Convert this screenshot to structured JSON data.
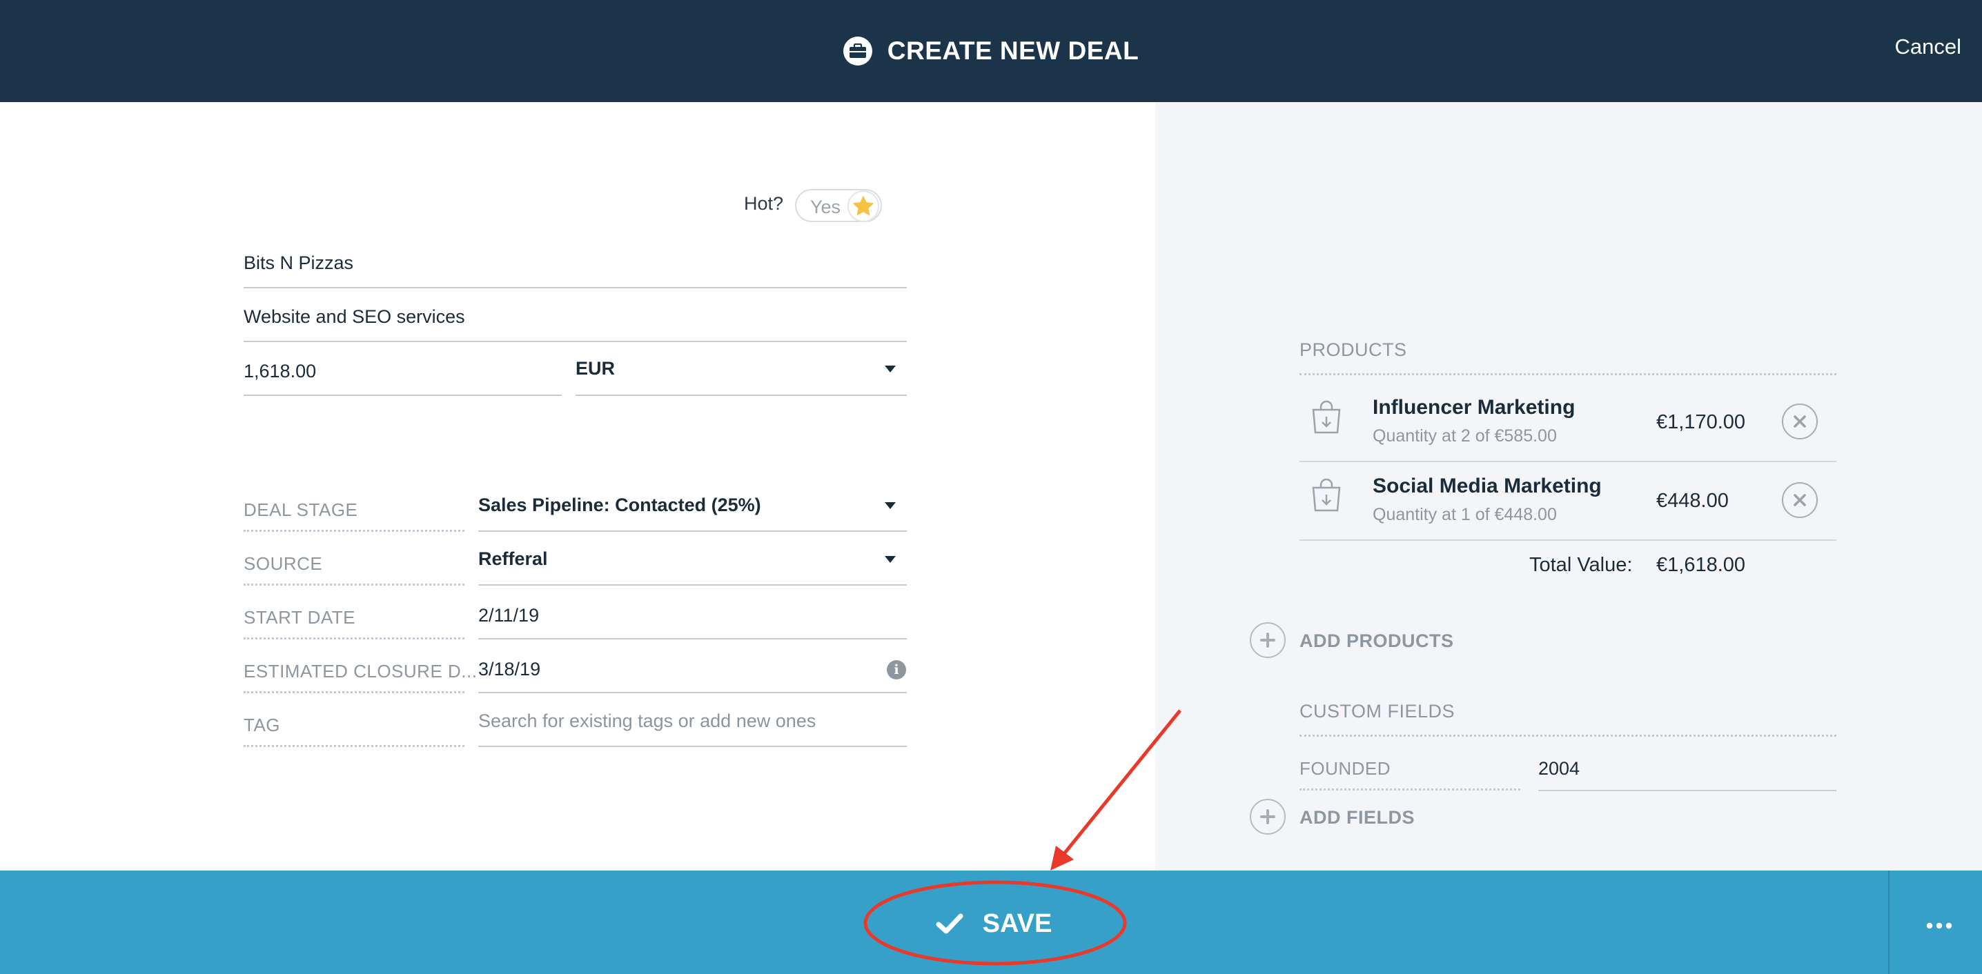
{
  "header": {
    "title": "CREATE NEW DEAL",
    "cancel_label": "Cancel",
    "icon": "briefcase-icon"
  },
  "hot": {
    "label": "Hot?",
    "toggle_label": "Yes",
    "icon": "star-icon",
    "star_color": "#f5c242"
  },
  "form": {
    "company": "Bits N Pizzas",
    "deal_name": "Website and SEO services",
    "amount": "1,618.00",
    "currency": "EUR",
    "rows": [
      {
        "label": "DEAL STAGE",
        "value": "Sales Pipeline: Contacted (25%)"
      },
      {
        "label": "SOURCE",
        "value": "Refferal"
      },
      {
        "label": "START DATE",
        "value": "2/11/19"
      },
      {
        "label": "ESTIMATED CLOSURE D...",
        "value": "3/18/19"
      },
      {
        "label": "TAG",
        "placeholder": "Search for existing tags or add new ones"
      }
    ]
  },
  "products": {
    "label": "PRODUCTS",
    "items": [
      {
        "name": "Influencer Marketing",
        "detail": "Quantity at 2 of €585.00",
        "price": "€1,170.00"
      },
      {
        "name": "Social Media Marketing",
        "detail": "Quantity at 1 of €448.00",
        "price": "€448.00"
      }
    ],
    "total_label": "Total Value:",
    "total_value": "€1,618.00",
    "add_label": "ADD PRODUCTS"
  },
  "custom_fields": {
    "label": "CUSTOM FIELDS",
    "fields": [
      {
        "label": "FOUNDED",
        "value": "2004"
      }
    ],
    "add_label": "ADD FIELDS"
  },
  "footer": {
    "save_label": "SAVE",
    "more_icon": "more-dots-icon"
  },
  "colors": {
    "header_bg": "#1b3449",
    "footer_bg": "#37a0c9",
    "right_pane_bg": "#f4f5f8",
    "annotation": "#e8392a"
  }
}
